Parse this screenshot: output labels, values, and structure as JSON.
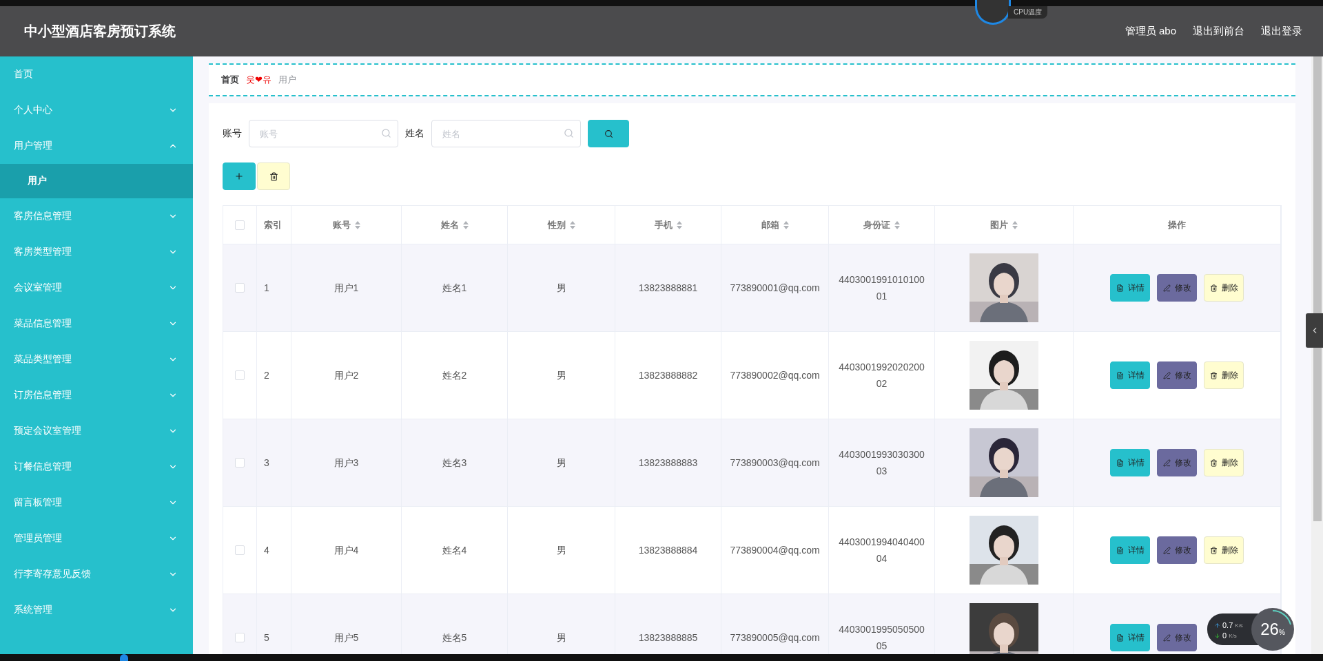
{
  "header": {
    "title": "中小型酒店客房预订系统",
    "links": [
      "管理员 abo",
      "退出到前台",
      "退出登录"
    ]
  },
  "cpu_widget": {
    "label": "CPU温度"
  },
  "sidebar": {
    "items": [
      {
        "label": "首页",
        "selected": false
      },
      {
        "label": "个人中心",
        "expanded": false,
        "selected": false
      },
      {
        "label": "用户管理",
        "expanded": true,
        "selected": false,
        "children": [
          {
            "label": "用户",
            "selected": true
          }
        ]
      },
      {
        "label": "客房信息管理",
        "expanded": false,
        "selected": false
      },
      {
        "label": "客房类型管理",
        "expanded": false,
        "selected": false
      },
      {
        "label": "会议室管理",
        "expanded": false,
        "selected": false
      },
      {
        "label": "菜品信息管理",
        "expanded": false,
        "selected": false
      },
      {
        "label": "菜品类型管理",
        "expanded": false,
        "selected": false
      },
      {
        "label": "订房信息管理",
        "expanded": false,
        "selected": false
      },
      {
        "label": "预定会议室管理",
        "expanded": false,
        "selected": false
      },
      {
        "label": "订餐信息管理",
        "expanded": false,
        "selected": false
      },
      {
        "label": "留言板管理",
        "expanded": false,
        "selected": false
      },
      {
        "label": "管理员管理",
        "expanded": false,
        "selected": false
      },
      {
        "label": "行李寄存意见反馈",
        "expanded": false,
        "selected": false
      },
      {
        "label": "系统管理",
        "expanded": false,
        "selected": false
      }
    ]
  },
  "breadcrumb": {
    "home": "首页",
    "separator": "웃❤유",
    "current": "用户"
  },
  "search": {
    "fields": [
      {
        "label": "账号",
        "placeholder": "账号"
      },
      {
        "label": "姓名",
        "placeholder": "姓名"
      }
    ]
  },
  "table": {
    "all_checked": false,
    "columns": [
      {
        "label": "索引",
        "sortable": false
      },
      {
        "label": "账号",
        "sortable": true
      },
      {
        "label": "姓名",
        "sortable": true
      },
      {
        "label": "性别",
        "sortable": true
      },
      {
        "label": "手机",
        "sortable": true
      },
      {
        "label": "邮箱",
        "sortable": true
      },
      {
        "label": "身份证",
        "sortable": true
      },
      {
        "label": "图片",
        "sortable": true
      },
      {
        "label": "操作",
        "sortable": false
      }
    ],
    "rows": [
      {
        "checked": false,
        "index": "1",
        "account": "用户1",
        "name": "姓名1",
        "gender": "男",
        "phone": "13823888881",
        "email": "773890001@qq.com",
        "id_card": "440300199101010001",
        "picture": {
          "kind": "picture"
        },
        "actions": [
          "详情",
          "修改",
          "删除"
        ]
      },
      {
        "checked": false,
        "index": "2",
        "account": "用户2",
        "name": "姓名2",
        "gender": "男",
        "phone": "13823888882",
        "email": "773890002@qq.com",
        "id_card": "440300199202020002",
        "picture": {
          "kind": "picture"
        },
        "actions": [
          "详情",
          "修改",
          "删除"
        ]
      },
      {
        "checked": false,
        "index": "3",
        "account": "用户3",
        "name": "姓名3",
        "gender": "男",
        "phone": "13823888883",
        "email": "773890003@qq.com",
        "id_card": "440300199303030003",
        "picture": {
          "kind": "picture"
        },
        "actions": [
          "详情",
          "修改",
          "删除"
        ]
      },
      {
        "checked": false,
        "index": "4",
        "account": "用户4",
        "name": "姓名4",
        "gender": "男",
        "phone": "13823888884",
        "email": "773890004@qq.com",
        "id_card": "440300199404040004",
        "picture": {
          "kind": "picture"
        },
        "actions": [
          "详情",
          "修改",
          "删除"
        ]
      },
      {
        "checked": false,
        "index": "5",
        "account": "用户5",
        "name": "姓名5",
        "gender": "男",
        "phone": "13823888885",
        "email": "773890005@qq.com",
        "id_card": "440300199505050005",
        "picture": {
          "kind": "picture"
        },
        "actions": [
          "详情",
          "修改"
        ]
      }
    ]
  },
  "net_widget": {
    "upload": "0.7",
    "upload_unit": "K/s",
    "download": "0",
    "download_unit": "K/s",
    "cpu": "26",
    "cpu_unit": "%"
  }
}
